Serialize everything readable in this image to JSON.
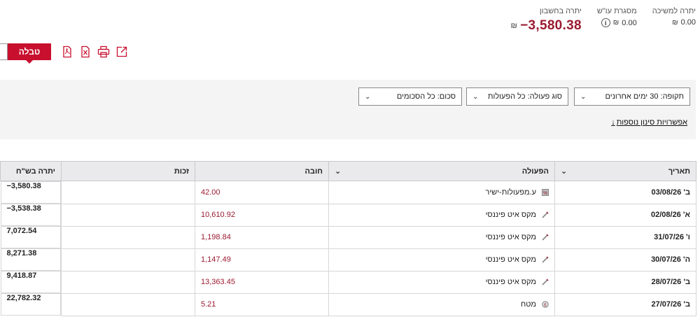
{
  "balances": {
    "account": {
      "label": "יתרה בחשבון",
      "value": "−3,580.38",
      "currency": "₪"
    },
    "credit_line": {
      "label": "מסגרת עו\"ש",
      "value": "0.00",
      "currency": "₪"
    },
    "withdraw": {
      "label": "יתרה למשיכה",
      "value": "0.00",
      "currency": "₪"
    }
  },
  "tabs": {
    "table": "טבלה"
  },
  "filters": {
    "period": "תקופה: 30 ימים אחרונים",
    "type": "סוג פעולה: כל הפעולות",
    "amount": "סכום: כל הסכומים",
    "more": "אפשרויות סינון נוספות"
  },
  "table": {
    "headers": {
      "date": "תאריך",
      "action": "הפעולה",
      "debit": "חובה",
      "credit": "זכות",
      "balance": "יתרה בש\"ח"
    },
    "rows": [
      {
        "date": "ב' 03/08/26",
        "icon": "commission-icon",
        "action": "ע.מפעולות-ישיר",
        "debit": "42.00",
        "credit": "",
        "balance": "−3,580.38"
      },
      {
        "date": "א' 02/08/26",
        "icon": "pen-icon",
        "action": "מקס איט פיננסי",
        "debit": "10,610.92",
        "credit": "",
        "balance": "−3,538.38"
      },
      {
        "date": "ו' 31/07/26",
        "icon": "pen-icon",
        "action": "מקס איט פיננסי",
        "debit": "1,198.84",
        "credit": "",
        "balance": "7,072.54"
      },
      {
        "date": "ה' 30/07/26",
        "icon": "pen-icon",
        "action": "מקס איט פיננסי",
        "debit": "1,147.49",
        "credit": "",
        "balance": "8,271.38"
      },
      {
        "date": "ב' 28/07/26",
        "icon": "pen-icon",
        "action": "מקס איט פיננסי",
        "debit": "13,363.45",
        "credit": "",
        "balance": "9,418.87"
      },
      {
        "date": "ב' 27/07/26",
        "icon": "currency-icon",
        "action": "מטח",
        "debit": "5.21",
        "credit": "",
        "balance": "22,782.32"
      }
    ]
  },
  "colors": {
    "accent": "#c8102e",
    "negative": "#9b1b30"
  }
}
